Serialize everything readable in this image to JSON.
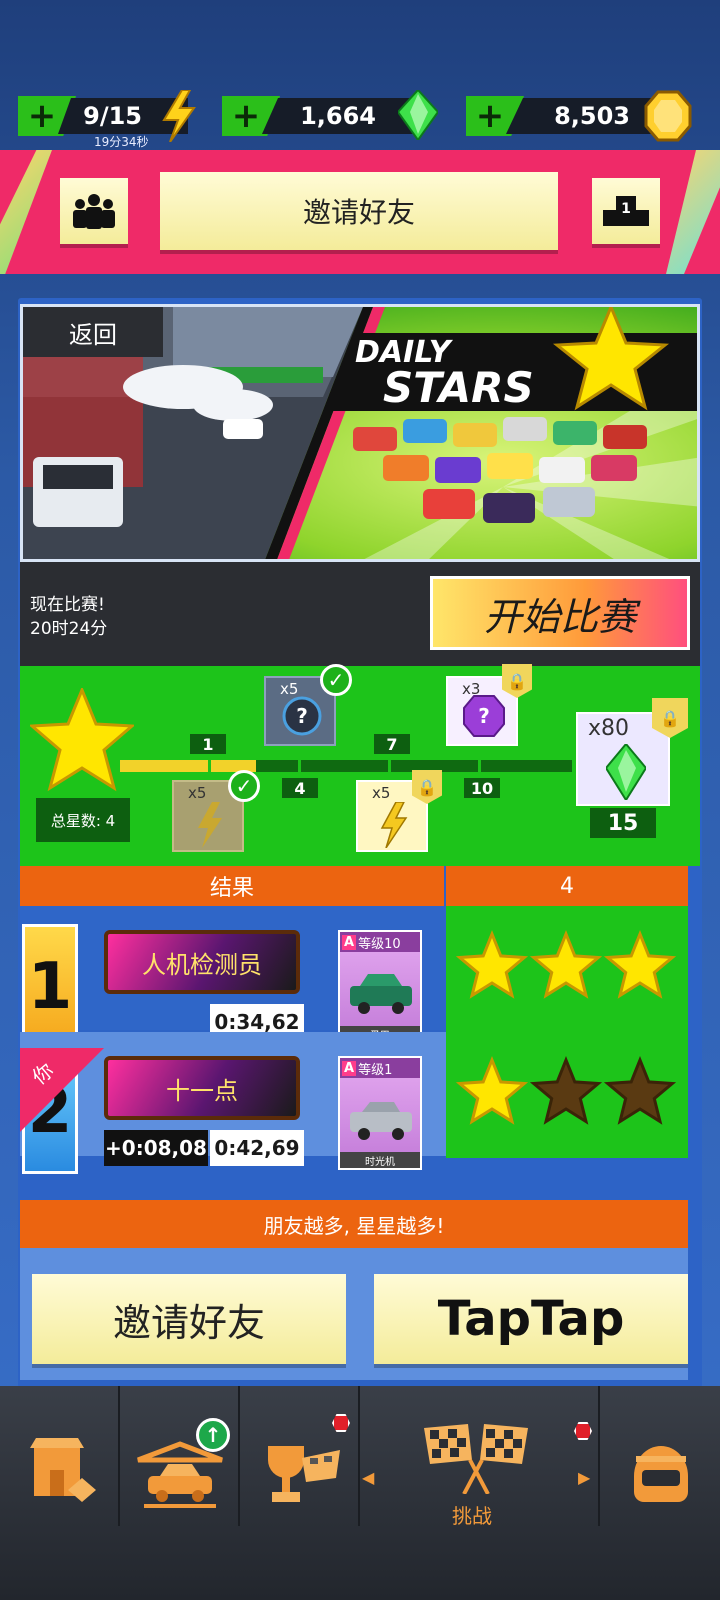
{
  "currency": {
    "energy": {
      "value": "9/15",
      "timer": "19分34秒"
    },
    "gems": {
      "value": "1,664"
    },
    "coins": {
      "value": "8,503"
    }
  },
  "banner": {
    "invite_label": "邀请好友",
    "leaderboard_badge": "1"
  },
  "event": {
    "back_label": "返回",
    "title_line1": "DAILY",
    "title_line2": "STARS",
    "status_line1": "现在比赛!",
    "status_line2": "20时24分",
    "start_label": "开始比赛"
  },
  "progress": {
    "total_stars_label": "总星数: 4",
    "filled_fraction": 0.3,
    "milestones": [
      "1",
      "4",
      "7",
      "10",
      "15"
    ],
    "rewards": [
      {
        "qty": "x5",
        "kind": "mystery-box",
        "claimed": true
      },
      {
        "qty": "x5",
        "kind": "energy",
        "claimed": true
      },
      {
        "qty": "x3",
        "kind": "mystery-gem",
        "locked": true
      },
      {
        "qty": "x5",
        "kind": "energy",
        "locked": true
      },
      {
        "qty": "x80",
        "kind": "gem",
        "locked": true
      }
    ]
  },
  "results": {
    "header_label": "结果",
    "header_stars": "4",
    "rows": [
      {
        "rank": "1",
        "name": "人机检测员",
        "diff": "",
        "time": "0:34,62",
        "car_level": "等级10",
        "car_name": "蚤巴",
        "stars": 3
      },
      {
        "rank": "2",
        "you_tag": "你",
        "name": "十一点",
        "diff": "+0:08,08",
        "time": "0:42,69",
        "car_level": "等级1",
        "car_name": "时光机",
        "stars": 1
      }
    ]
  },
  "promo": {
    "label": "朋友越多, 星星越多!",
    "invite_label": "邀请好友",
    "taptap_label": "TapTap"
  },
  "nav": {
    "active_label": "挑战"
  },
  "colors": {
    "green": "#1dc41a",
    "pink": "#ef2a68",
    "orange": "#ec6410",
    "yellow": "#f5e98c"
  }
}
